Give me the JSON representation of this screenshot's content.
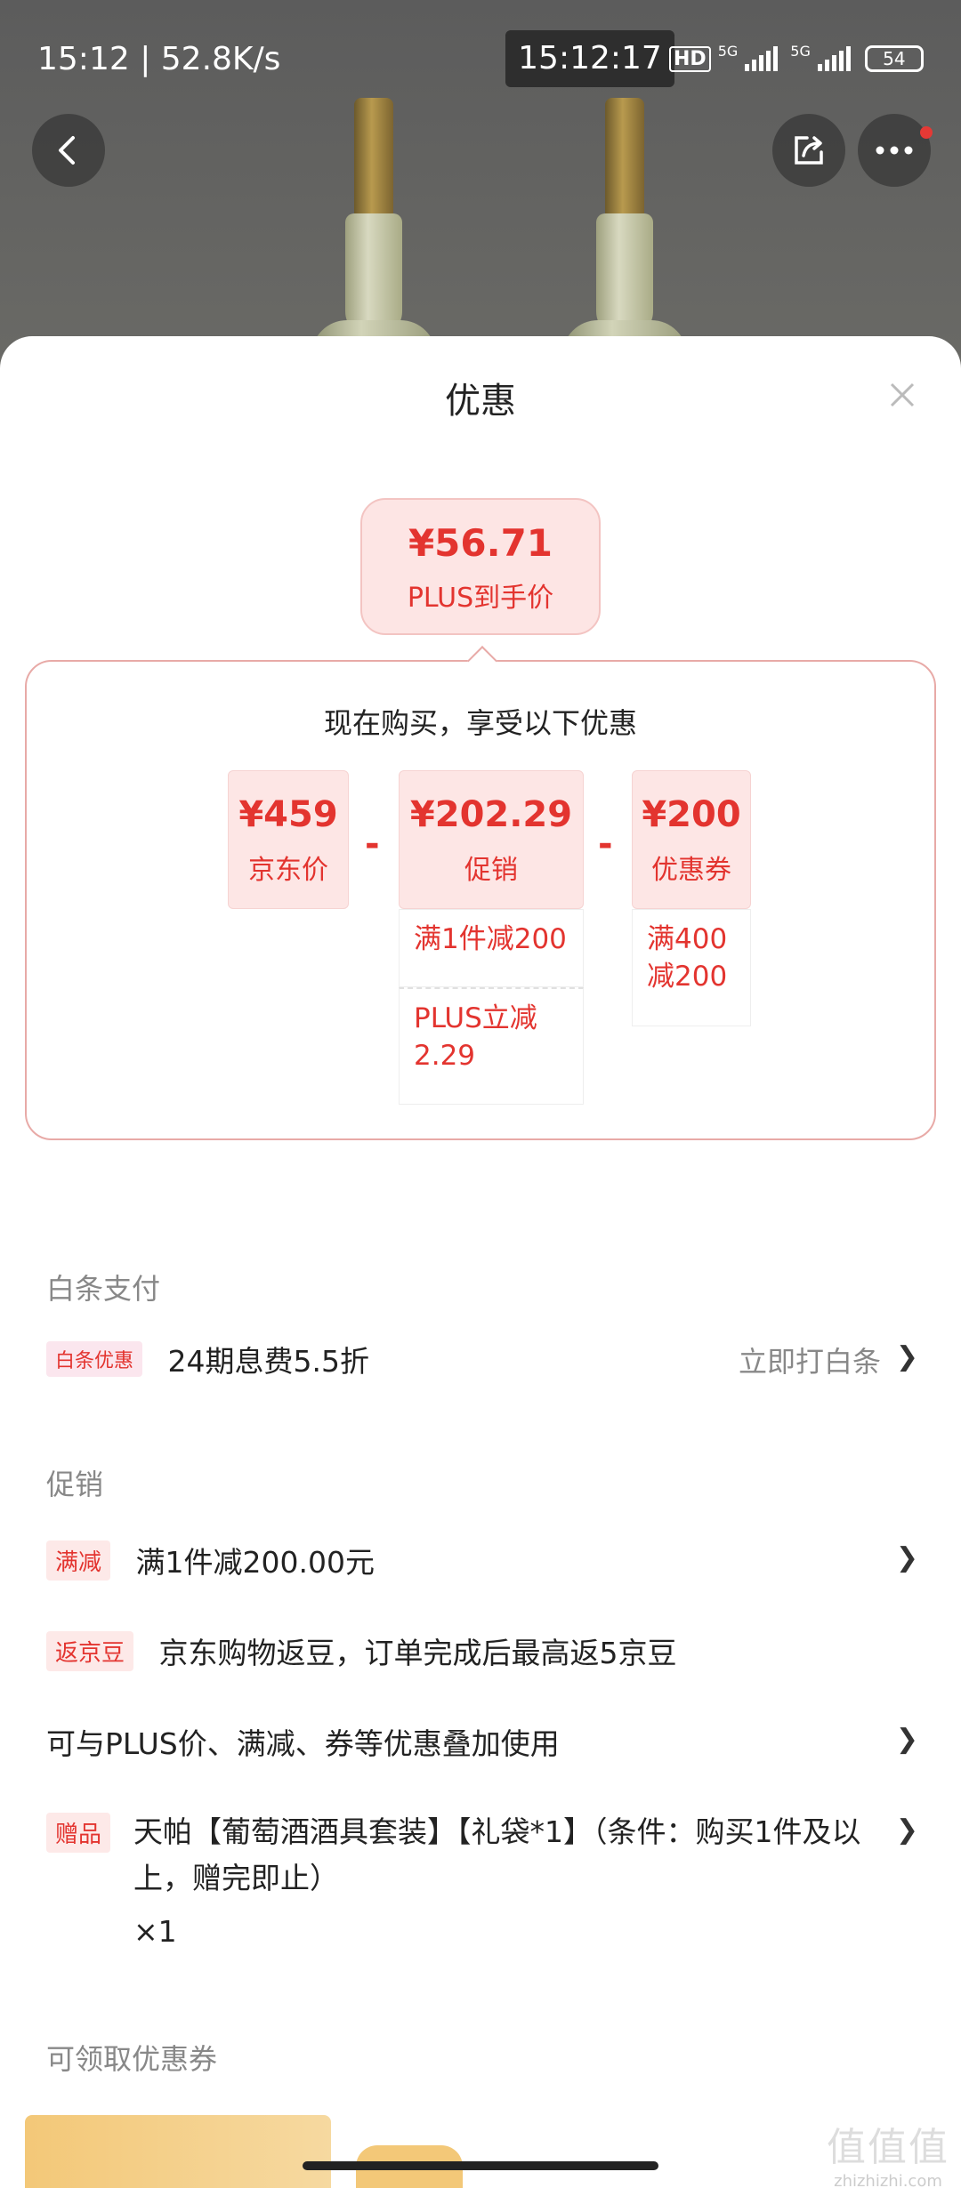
{
  "status_bar": {
    "time_speed": "15:12 | 52.8K/s",
    "clock": "15:12:17",
    "network_1": "HD",
    "network_2": "5G",
    "network_3": "5G",
    "battery": "54"
  },
  "sheet": {
    "title": "优惠",
    "final_price": {
      "amount": "¥56.71",
      "label": "PLUS到手价"
    },
    "breakdown": {
      "title": "现在购买，享受以下优惠",
      "jd_price": {
        "value": "¥459",
        "label": "京东价"
      },
      "minus": "-",
      "promo": {
        "value": "¥202.29",
        "label": "促销",
        "details": [
          "满1件减200",
          "PLUS立减2.29"
        ]
      },
      "coupon": {
        "value": "¥200",
        "label": "优惠券",
        "details": [
          "满400减200"
        ]
      }
    },
    "baitiao": {
      "heading": "白条支付",
      "tag": "白条优惠",
      "text": "24期息费5.5折",
      "action": "立即打白条",
      "chevron": "❯"
    },
    "promotion": {
      "heading": "促销",
      "items": [
        {
          "tag": "满减",
          "text": "满1件减200.00元",
          "chevron": "❯"
        },
        {
          "tag": "返京豆",
          "text": "京东购物返豆，订单完成后最高返5京豆"
        },
        {
          "text": "可与PLUS价、满减、券等优惠叠加使用",
          "chevron": "❯"
        },
        {
          "tag": "赠品",
          "text": "天帕【葡萄酒酒具套装】【礼袋*1】（条件：购买1件及以上，赠完即止）",
          "qty": "×1",
          "chevron": "❯"
        }
      ]
    },
    "coupons": {
      "heading": "可领取优惠券"
    }
  },
  "watermark": {
    "big": "值值值",
    "small": "zhizhizhi.com"
  }
}
